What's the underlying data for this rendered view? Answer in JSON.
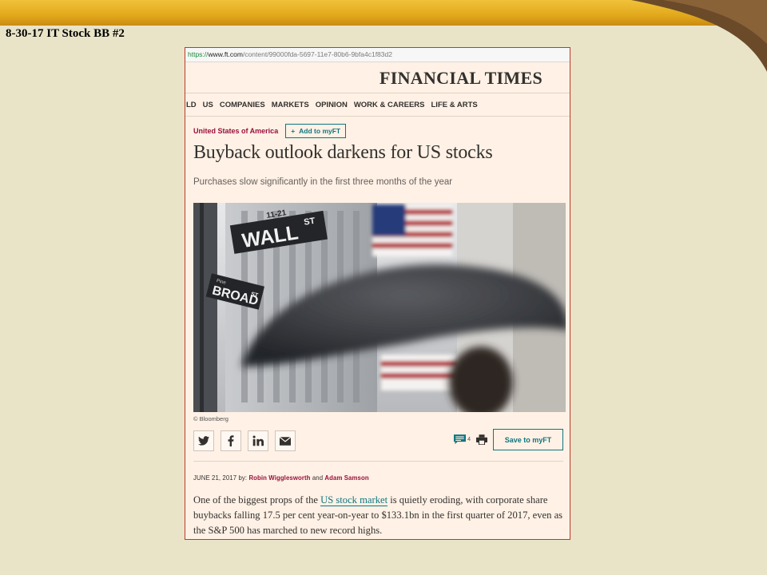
{
  "slide": {
    "title": "8-30-17 IT Stock BB #2",
    "colors": {
      "banner": "#e2a81c",
      "swoosh": "#6b4a2a",
      "background": "#e9e4c8"
    }
  },
  "browser": {
    "url_protocol": "https://",
    "url_domain": "www.ft.com",
    "url_path": "/content/99000fda-5697-11e7-80b6-9bfa4c1f83d2"
  },
  "masthead": {
    "logo": "FINANCIAL TIMES"
  },
  "nav": {
    "items": [
      "LD",
      "US",
      "COMPANIES",
      "MARKETS",
      "OPINION",
      "WORK & CAREERS",
      "LIFE & ARTS"
    ]
  },
  "article": {
    "topic": "United States of America",
    "add_myft_label": "Add to myFT",
    "headline": "Buyback outlook darkens for US stocks",
    "standfirst": "Purchases slow significantly in the first three months of the year",
    "image_signs": {
      "wall": "WALL",
      "wall_suffix": "ST",
      "number": "11-21",
      "broad": "BROAD",
      "broad_suffix": "ST",
      "small": "Pine"
    },
    "caption": "© Bloomberg",
    "share_icons": [
      "twitter-icon",
      "facebook-icon",
      "linkedin-icon",
      "email-icon"
    ],
    "comment_count": "4",
    "save_label": "Save to myFT",
    "byline": {
      "date": "JUNE 21, 2017",
      "by": "by:",
      "author1": "Robin Wigglesworth",
      "and": "and",
      "author2": "Adam Samson"
    },
    "body": {
      "before": "One of the biggest props of the ",
      "link": "US stock market",
      "after": " is quietly eroding, with corporate share buybacks falling 17.5 per cent year-on-year to $133.1bn in the first quarter of 2017, even as the S&P 500 has marched to new record highs."
    },
    "colors": {
      "claret": "#990f3d",
      "teal": "#0d7680",
      "paper": "#fff1e5"
    }
  }
}
